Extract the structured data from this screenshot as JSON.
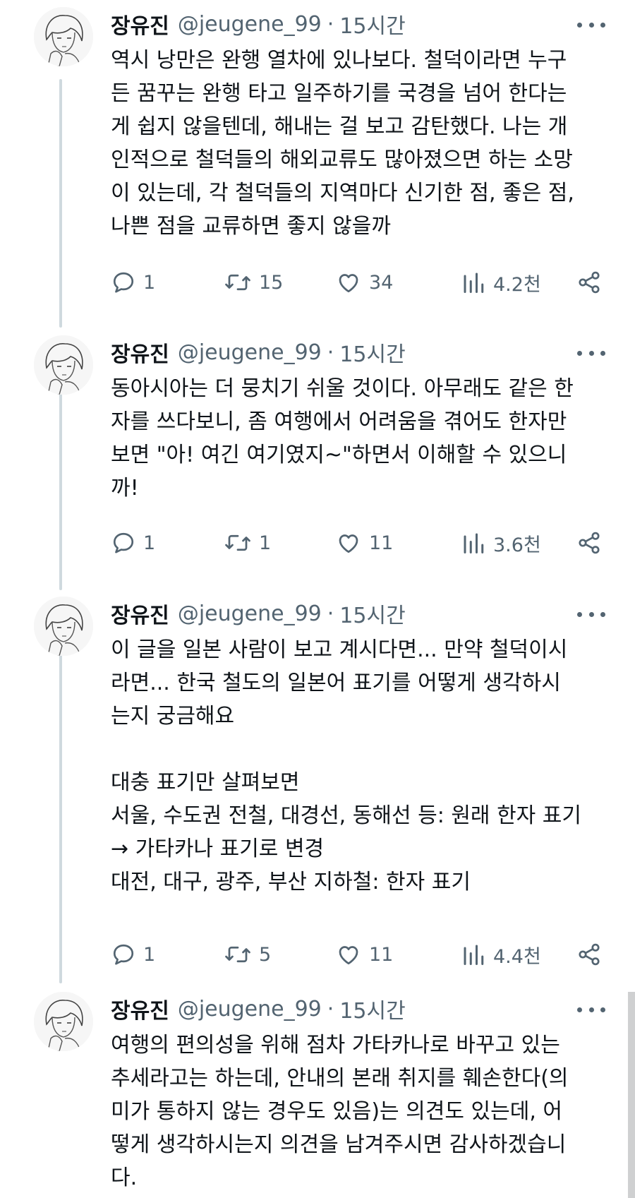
{
  "tweets": [
    {
      "name": "장유진",
      "handle": "@jeugene_99",
      "separator": "·",
      "time": "15시간",
      "lines": [
        "역시 낭만은 완행 열차에 있나보다. 철덕이라면 누구",
        "든 꿈꾸는 완행 타고 일주하기를 국경을 넘어 한다는",
        "게 쉽지 않을텐데, 해내는 걸 보고 감탄했다. 나는 개",
        "인적으로 철덕들의 해외교류도 많아졌으면 하는 소망",
        "이 있는데, 각 철덕들의 지역마다 신기한 점, 좋은 점,",
        "나쁜 점을 교류하면 좋지 않을까"
      ],
      "replies": "1",
      "retweets": "15",
      "likes": "34",
      "views": "4.2천"
    },
    {
      "name": "장유진",
      "handle": "@jeugene_99",
      "separator": "·",
      "time": "15시간",
      "lines": [
        "동아시아는 더 뭉치기 쉬울 것이다. 아무래도 같은 한",
        "자를 쓰다보니, 좀 여행에서 어려움을 겪어도 한자만",
        "보면 \"아! 여긴 여기였지~\"하면서 이해할 수 있으니",
        "까!"
      ],
      "replies": "1",
      "retweets": "1",
      "likes": "11",
      "views": "3.6천"
    },
    {
      "name": "장유진",
      "handle": "@jeugene_99",
      "separator": "·",
      "time": "15시간",
      "lines": [
        "이 글을 일본 사람이 보고 계시다면... 만약 철덕이시",
        "라면... 한국 철도의 일본어 표기를 어떻게 생각하시",
        "는지 궁금해요",
        "",
        "대충 표기만 살펴보면",
        "서울, 수도권 전철, 대경선, 동해선 등: 원래 한자 표기",
        "→ 가타카나 표기로 변경",
        "대전, 대구, 광주, 부산 지하철: 한자 표기"
      ],
      "replies": "1",
      "retweets": "5",
      "likes": "11",
      "views": "4.4천"
    },
    {
      "name": "장유진",
      "handle": "@jeugene_99",
      "separator": "·",
      "time": "15시간",
      "lines": [
        "여행의 편의성을 위해 점차 가타카나로 바꾸고 있는",
        "추세라고는 하는데, 안내의 본래 취지를 훼손한다(의",
        "미가 통하지 않는 경우도 있음)는 의견도 있는데, 어",
        "떻게 생각하시는지 의견을 남겨주시면 감사하겠습니",
        "다."
      ]
    }
  ]
}
